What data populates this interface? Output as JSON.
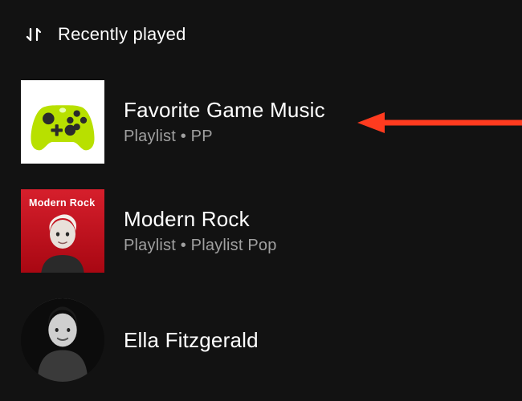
{
  "header": {
    "sort_label": "Recently played"
  },
  "items": [
    {
      "title": "Favorite Game Music",
      "subtitle": "Playlist • PP",
      "thumb_label": ""
    },
    {
      "title": "Modern Rock",
      "subtitle": "Playlist • Playlist Pop",
      "thumb_label": "Modern Rock"
    },
    {
      "title": "Ella Fitzgerald",
      "subtitle": "",
      "thumb_label": ""
    }
  ],
  "annotation": {
    "arrow_color": "#ff3b1f"
  }
}
